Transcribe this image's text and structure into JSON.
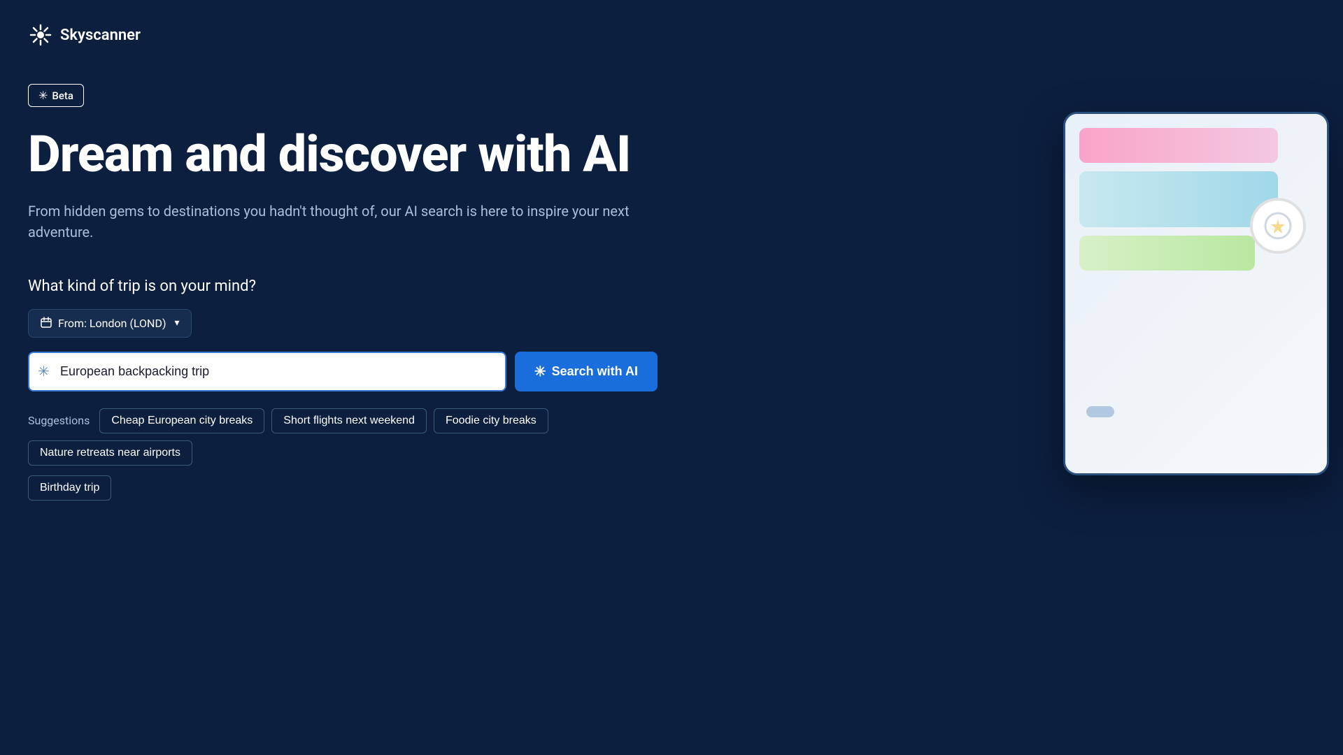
{
  "header": {
    "logo_text": "Skyscanner"
  },
  "beta": {
    "label": "Beta"
  },
  "hero": {
    "headline": "Dream and discover with AI",
    "subtitle": "From hidden gems to destinations you hadn't thought of, our AI search is here to inspire your next adventure.",
    "question": "What kind of trip is on your mind?"
  },
  "from_selector": {
    "label": "From: London (LOND)"
  },
  "search": {
    "placeholder": "European backpacking trip",
    "current_value": "European backpacking trip",
    "button_label": "Search with AI"
  },
  "suggestions": {
    "label": "Suggestions",
    "chips_row1": [
      "Cheap European city breaks",
      "Short flights next weekend",
      "Foodie city breaks",
      "Nature retreats near airports"
    ],
    "chips_row2": [
      "Birthday trip"
    ]
  },
  "colors": {
    "background": "#0c1f3f",
    "accent_blue": "#1a6edb",
    "border_blue": "#3a7bd5",
    "text_muted": "#a8c0d8"
  }
}
